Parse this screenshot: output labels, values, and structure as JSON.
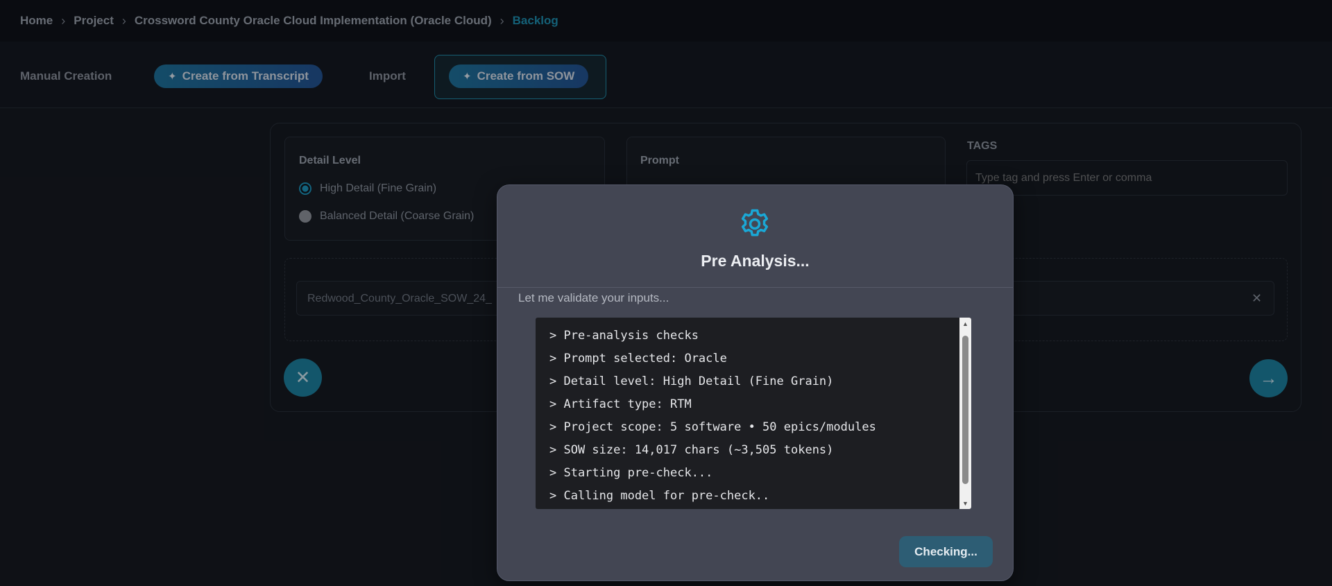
{
  "breadcrumb": {
    "items": [
      "Home",
      "Project",
      "Crossword County Oracle Cloud Implementation (Oracle Cloud)"
    ],
    "current": "Backlog"
  },
  "tabs": {
    "manual": "Manual Creation",
    "transcript": "Create from Transcript",
    "import": "Import",
    "sow": "Create from SOW"
  },
  "form": {
    "detail_level": {
      "title": "Detail Level",
      "options": [
        "High Detail (Fine Grain)",
        "Balanced Detail (Coarse Grain)"
      ],
      "selected": "High Detail (Fine Grain)"
    },
    "prompt": {
      "title": "Prompt"
    },
    "tags": {
      "label": "TAGS",
      "placeholder": "Type tag and press Enter or comma"
    },
    "file": {
      "name": "Redwood_County_Oracle_SOW_24_"
    }
  },
  "modal": {
    "title": "Pre Analysis...",
    "subtitle": "Let me validate your inputs...",
    "lines": [
      "> Pre-analysis checks",
      "> Prompt selected: Oracle",
      "> Detail level: High Detail (Fine Grain)",
      "> Artifact type: RTM",
      "> Project scope: 5 software • 50 epics/modules",
      "> SOW size: 14,017 chars (~3,505 tokens)",
      "> Starting pre-check...",
      "> Calling model for pre-check.."
    ],
    "button": "Checking..."
  },
  "icons": {
    "gear": "gear-icon",
    "sparkle": "sparkle-icon",
    "close": "close-icon",
    "arrow": "arrow-right-icon"
  },
  "colors": {
    "accent": "#1a93b8",
    "modal_bg": "#434653",
    "page_bg": "#111419"
  }
}
